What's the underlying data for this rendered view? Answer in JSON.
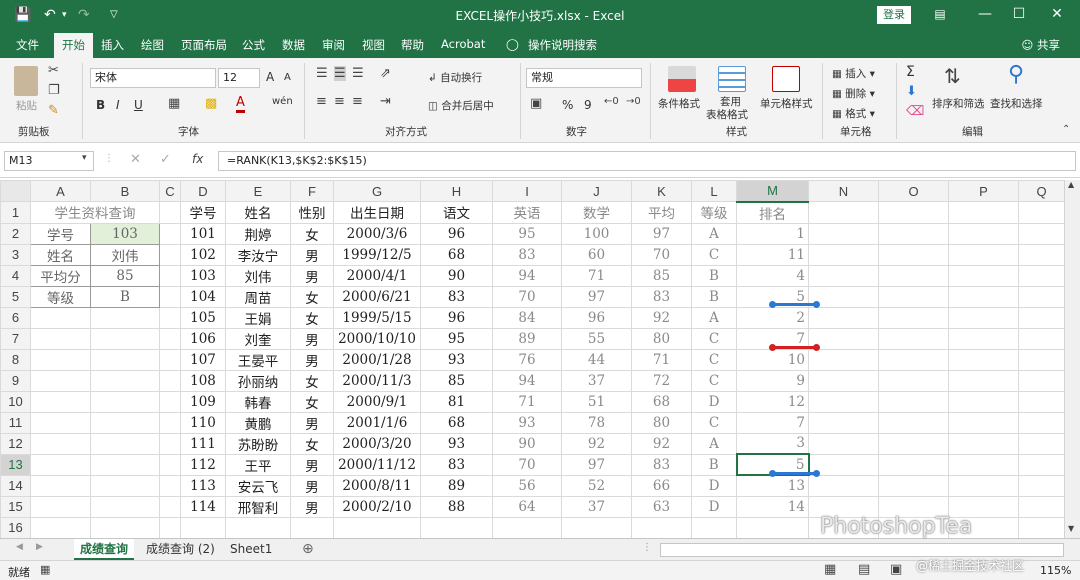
{
  "window": {
    "title": "EXCEL操作小技巧.xlsx - Excel",
    "login": "登录"
  },
  "ribbon_tabs": [
    "文件",
    "开始",
    "插入",
    "绘图",
    "页面布局",
    "公式",
    "数据",
    "审阅",
    "视图",
    "帮助",
    "Acrobat",
    "操作说明搜索"
  ],
  "active_tab": "开始",
  "share": "共享",
  "ribbon": {
    "clipboard": {
      "paste": "粘贴",
      "label": "剪贴板"
    },
    "font": {
      "name": "宋体",
      "size": "12",
      "label": "字体",
      "bold": "B",
      "italic": "I",
      "underline": "U",
      "font_color_letter": "A",
      "grow": "A",
      "shrink": "A",
      "wen": "wén"
    },
    "alignment": {
      "wrap": "自动换行",
      "merge": "合并后居中",
      "label": "对齐方式"
    },
    "number": {
      "format": "常规",
      "percent": "%",
      "comma": "9",
      "label": "数字"
    },
    "styles": {
      "conditional": "条件格式",
      "table1": "套用",
      "table2": "表格格式",
      "cell_styles": "单元格样式",
      "label": "样式"
    },
    "cells": {
      "insert": "插入",
      "delete": "删除",
      "format": "格式",
      "label": "单元格"
    },
    "editing": {
      "sigma": "Σ",
      "sort": "排序和筛选",
      "find": "查找和选择",
      "label": "编辑"
    }
  },
  "formula_bar": {
    "name_box": "M13",
    "fx": "fx",
    "formula": "=RANK(K13,$K$2:$K$15)"
  },
  "columns": [
    "A",
    "B",
    "C",
    "D",
    "E",
    "F",
    "G",
    "H",
    "I",
    "J",
    "K",
    "L",
    "M",
    "N",
    "O",
    "P",
    "Q"
  ],
  "rows": [
    "1",
    "2",
    "3",
    "4",
    "5",
    "6",
    "7",
    "8",
    "9",
    "10",
    "11",
    "12",
    "13",
    "14",
    "15",
    "16"
  ],
  "query_panel": {
    "title": "学生资料查询",
    "fields": [
      {
        "label": "学号",
        "value": "103"
      },
      {
        "label": "姓名",
        "value": "刘伟"
      },
      {
        "label": "平均分",
        "value": "85"
      },
      {
        "label": "等级",
        "value": "B"
      }
    ]
  },
  "table": {
    "headers": [
      "学号",
      "姓名",
      "性别",
      "出生日期",
      "语文",
      "英语",
      "数学",
      "平均",
      "等级",
      "排名"
    ],
    "rows": [
      [
        "101",
        "荆婷",
        "女",
        "2000/3/6",
        "96",
        "95",
        "100",
        "97",
        "A",
        "1"
      ],
      [
        "102",
        "李汝宁",
        "男",
        "1999/12/5",
        "68",
        "83",
        "60",
        "70",
        "C",
        "11"
      ],
      [
        "103",
        "刘伟",
        "男",
        "2000/4/1",
        "90",
        "94",
        "71",
        "85",
        "B",
        "4"
      ],
      [
        "104",
        "周苗",
        "女",
        "2000/6/21",
        "83",
        "70",
        "97",
        "83",
        "B",
        "5"
      ],
      [
        "105",
        "王娟",
        "女",
        "1999/5/15",
        "96",
        "84",
        "96",
        "92",
        "A",
        "2"
      ],
      [
        "106",
        "刘奎",
        "男",
        "2000/10/10",
        "95",
        "89",
        "55",
        "80",
        "C",
        "7"
      ],
      [
        "107",
        "王晏平",
        "男",
        "2000/1/28",
        "93",
        "76",
        "44",
        "71",
        "C",
        "10"
      ],
      [
        "108",
        "孙丽纳",
        "女",
        "2000/11/3",
        "85",
        "94",
        "37",
        "72",
        "C",
        "9"
      ],
      [
        "109",
        "韩春",
        "女",
        "2000/9/1",
        "81",
        "71",
        "51",
        "68",
        "D",
        "12"
      ],
      [
        "110",
        "黄鹏",
        "男",
        "2001/1/6",
        "68",
        "93",
        "78",
        "80",
        "C",
        "7"
      ],
      [
        "111",
        "苏盼盼",
        "女",
        "2000/3/20",
        "93",
        "90",
        "92",
        "92",
        "A",
        "3"
      ],
      [
        "112",
        "王平",
        "男",
        "2000/11/12",
        "83",
        "70",
        "97",
        "83",
        "B",
        "5"
      ],
      [
        "113",
        "安云飞",
        "男",
        "2000/8/11",
        "89",
        "56",
        "52",
        "66",
        "D",
        "13"
      ],
      [
        "114",
        "邢智利",
        "男",
        "2000/2/10",
        "88",
        "64",
        "37",
        "63",
        "D",
        "14"
      ]
    ]
  },
  "sheets": [
    "成绩查询",
    "成绩查询 (2)",
    "Sheet1"
  ],
  "active_sheet": "成绩查询",
  "status": {
    "ready": "就绪",
    "zoom": "115%"
  },
  "watermark": "PhotoshopTea",
  "watermark2": "@稀土掘金技术社区",
  "colors": {
    "excel_green": "#217346",
    "blue_mark": "#2b78d4",
    "red_mark": "#d32020"
  }
}
